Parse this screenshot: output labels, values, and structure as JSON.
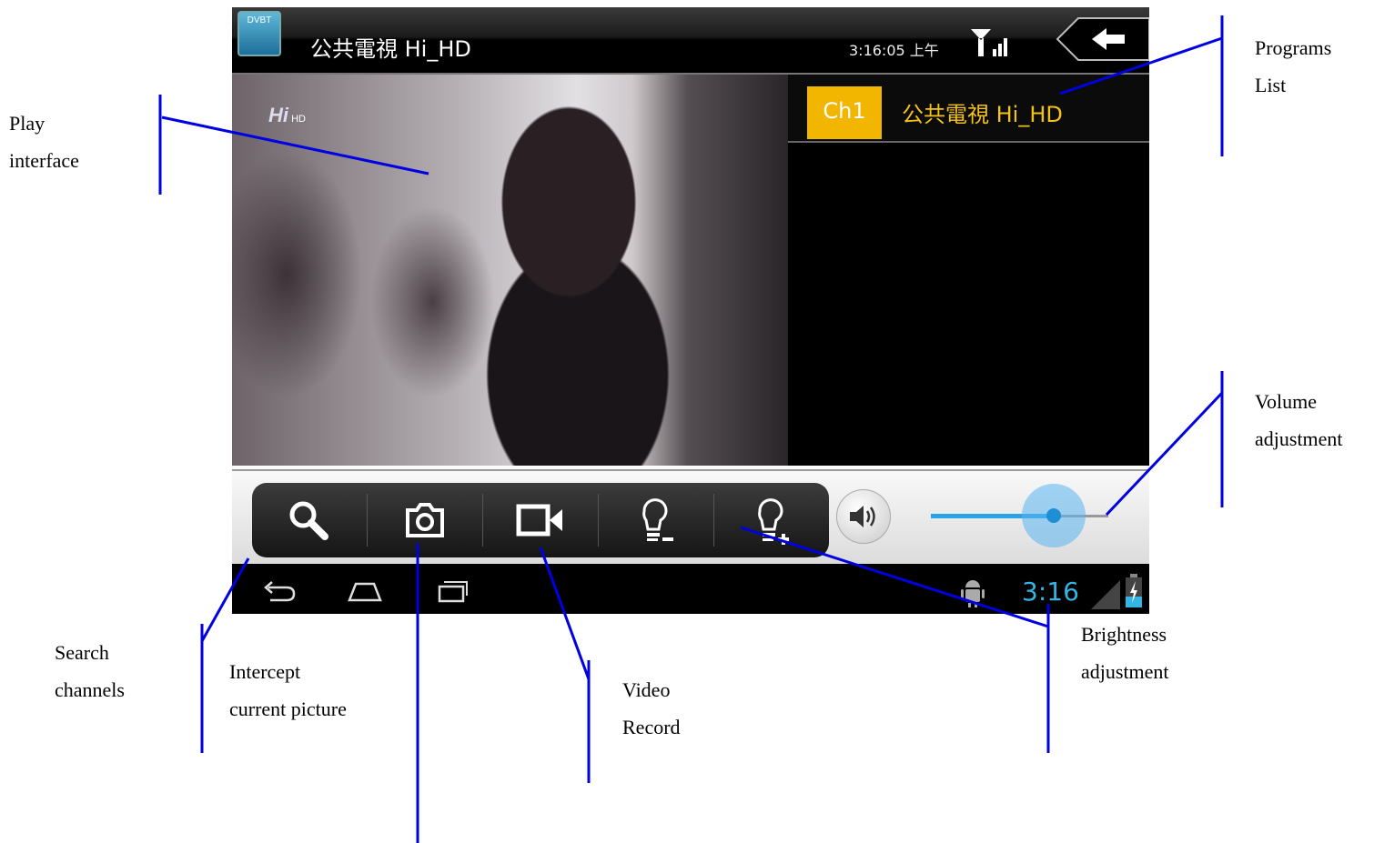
{
  "app": {
    "icon_label": "DVBT",
    "title": "公共電視 Hi_HD",
    "clock": "3:16:05 上午"
  },
  "video": {
    "logo": "Hi",
    "logo_sub": "HD"
  },
  "program_list": {
    "items": [
      {
        "channel": "Ch1",
        "name": "公共電視 Hi_HD"
      }
    ]
  },
  "toolbar": {
    "tools": [
      "search-icon",
      "camera-icon",
      "video-camera-icon",
      "brightness-down-icon",
      "brightness-up-icon"
    ],
    "volume_icon": "speaker-icon",
    "volume_level": 0.7
  },
  "navbar": {
    "clock": "3:16"
  },
  "annotations": {
    "play_interface": [
      "Play",
      "interface"
    ],
    "programs_list": [
      "Programs",
      "List"
    ],
    "volume_adjustment": [
      "Volume",
      "adjustment"
    ],
    "search_channels": [
      "Search",
      "channels"
    ],
    "intercept_picture": [
      "Intercept",
      "current picture"
    ],
    "video_record": [
      "Video",
      "Record"
    ],
    "brightness_adjustment": [
      "Brightness",
      "adjustment"
    ]
  },
  "colors": {
    "annotation_line": "#0000e0",
    "channel_badge": "#f3b600",
    "channel_name": "#f3c21a",
    "accent_blue": "#33b5e5"
  }
}
